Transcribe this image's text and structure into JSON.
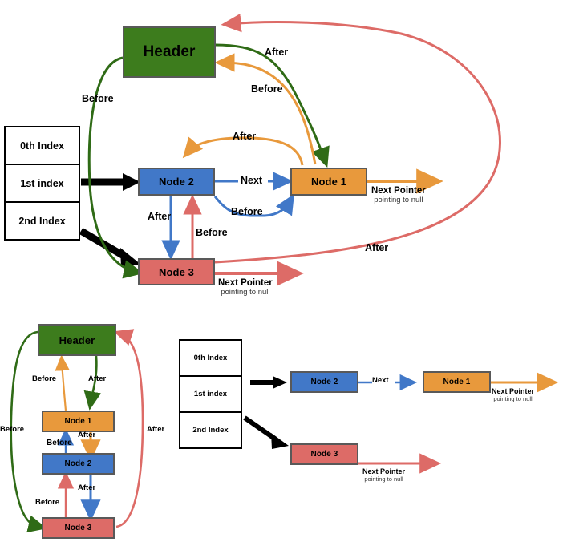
{
  "diagram": {
    "title": "Doubly linked list with header and index table",
    "colors": {
      "header_green": "#3d7c1d",
      "node1_orange": "#e8993c",
      "node2_blue": "#4178c8",
      "node3_red": "#dd6b67",
      "index_black": "#000000",
      "box_border": "#595959"
    }
  },
  "top": {
    "header_label": "Header",
    "index_table": {
      "rows": [
        "0th Index",
        "1st index",
        "2nd Index"
      ]
    },
    "nodes": {
      "node1": "Node 1",
      "node2": "Node 2",
      "node3": "Node 3"
    },
    "edges": {
      "header_after_node1": "After",
      "node1_before_header": "Before",
      "header_before_node3": "Before",
      "node3_after_header": "After",
      "node1_after_node2": "After",
      "node2_next_node1": "Next",
      "node2_before_node1": "Before",
      "node2_after_node3": "After",
      "node3_before_node2": "Before"
    },
    "next_pointer": {
      "line1": "Next Pointer",
      "line2": "pointing to null"
    }
  },
  "bottom_left": {
    "header_label": "Header",
    "nodes": {
      "node1": "Node 1",
      "node2": "Node 2",
      "node3": "Node 3"
    },
    "edges": {
      "node1_before_header": "Before",
      "header_after_node1": "After",
      "node1_after_node2": "After",
      "node2_before_node1": "Before",
      "node2_after_node3": "After",
      "node3_before_node2": "Before",
      "header_before_node3": "Before",
      "node3_after_header": "After"
    }
  },
  "bottom_right": {
    "index_table": {
      "rows": [
        "0th Index",
        "1st index",
        "2nd Index"
      ]
    },
    "nodes": {
      "node1": "Node 1",
      "node2": "Node 2",
      "node3": "Node 3"
    },
    "edges": {
      "node2_next_node1": "Next"
    },
    "next_pointer": {
      "line1": "Next Pointer",
      "line2": "pointing to null"
    }
  }
}
